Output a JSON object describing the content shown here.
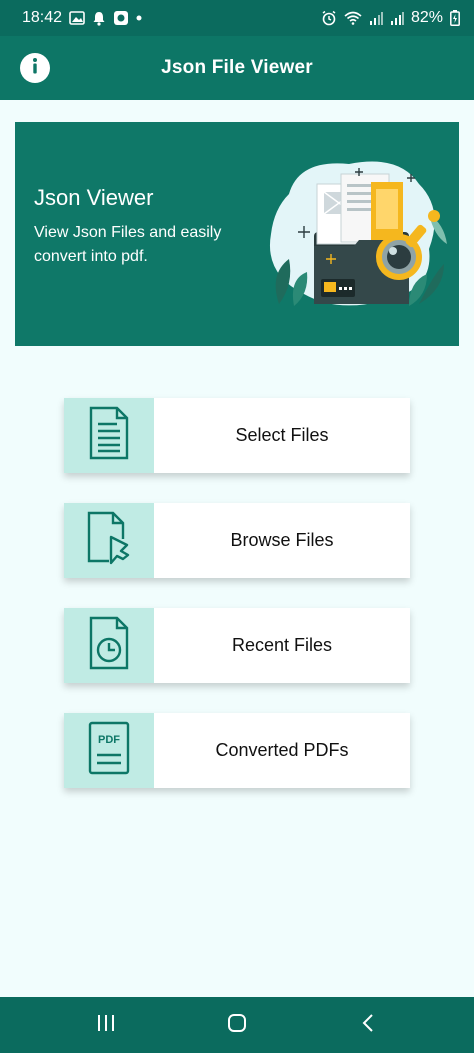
{
  "status_bar": {
    "time": "18:42",
    "battery": "82%"
  },
  "app_bar": {
    "title": "Json File Viewer"
  },
  "banner": {
    "title": "Json Viewer",
    "subtitle": "View Json Files and easily convert into pdf."
  },
  "actions": [
    {
      "label": "Select Files",
      "icon": "document-lines-icon"
    },
    {
      "label": "Browse Files",
      "icon": "document-cursor-icon"
    },
    {
      "label": "Recent Files",
      "icon": "document-clock-icon"
    },
    {
      "label": "Converted PDFs",
      "icon": "pdf-document-icon"
    }
  ],
  "colors": {
    "primary": "#0d7666",
    "icon_box": "#c0ebe4",
    "background": "#f1fdfd",
    "accent": "#f5b71e"
  }
}
